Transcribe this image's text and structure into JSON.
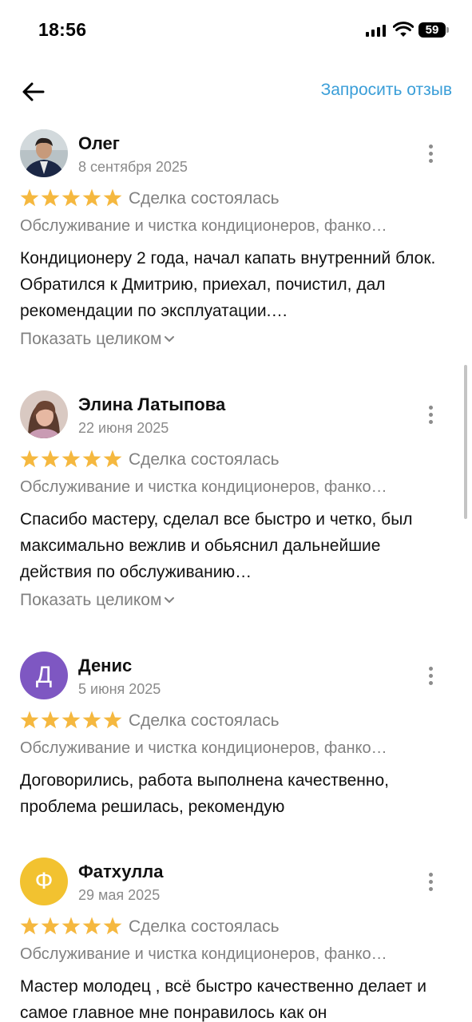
{
  "status_bar": {
    "time": "18:56",
    "battery_level": "59",
    "signal_icon": "cellular-signal-icon",
    "wifi_icon": "wifi-icon",
    "battery_icon": "battery-icon"
  },
  "header": {
    "back_icon": "arrow-left-icon",
    "request_review_label": "Запросить отзыв",
    "accent_color": "#3a9ed8"
  },
  "reviews": [
    {
      "author": "Олег",
      "date": "8 сентября 2025",
      "rating": 5,
      "deal_status": "Сделка состоялась",
      "service": "Обслуживание и чистка кондиционеров, фанко…",
      "text": "Кондиционеру 2 года, начал капать внутренний блок. Обратился к Дмитрию, приехал, почистил, дал рекомендации по эксплуатации.…",
      "show_full_label": "Показать целиком",
      "avatar": "photo"
    },
    {
      "author": "Элина Латыпова",
      "date": "22 июня 2025",
      "rating": 5,
      "deal_status": "Сделка состоялась",
      "service": "Обслуживание и чистка кондиционеров, фанко…",
      "text": "Спасибо мастеру, сделал все быстро и четко, был максимально вежлив и обьяснил дальнейшие действия по обслуживанию…",
      "show_full_label": "Показать целиком",
      "avatar": "photo"
    },
    {
      "author": "Денис",
      "date": "5 июня 2025",
      "rating": 5,
      "deal_status": "Сделка состоялась",
      "service": "Обслуживание и чистка кондиционеров, фанко…",
      "text": "Договорились, работа выполнена качественно, проблема решилась, рекомендую",
      "avatar_letter": "Д",
      "avatar_color": "#7e57c2"
    },
    {
      "author": "Фатхулла",
      "date": "29 мая 2025",
      "rating": 5,
      "deal_status": "Сделка состоялась",
      "service": "Обслуживание и чистка кондиционеров, фанко…",
      "text": "Мастер молодец , всё быстро качественно делает и самое главное мне понравилось как он",
      "avatar_letter": "Ф",
      "avatar_color": "#f2c230"
    }
  ],
  "colors": {
    "star": "#f5b83f",
    "secondary_text": "#808080"
  }
}
